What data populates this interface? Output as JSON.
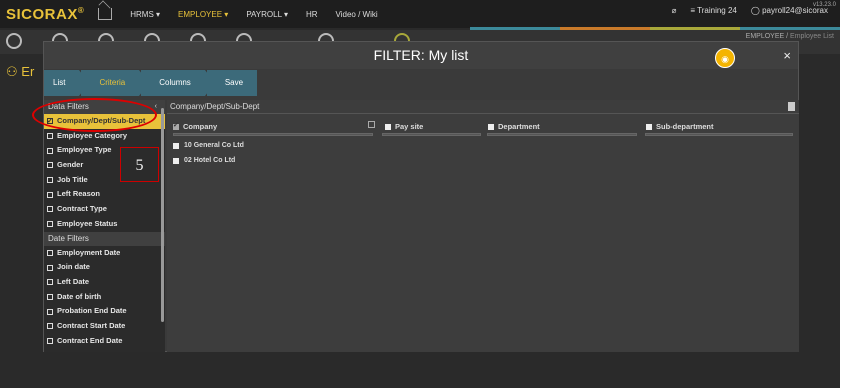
{
  "app": {
    "logo": "SICORAX",
    "logo_mark": "®",
    "version": "v13.23.0",
    "nav": [
      "HRMS ▾",
      "EMPLOYEE ▾",
      "PAYROLL ▾",
      "HR",
      "Video / Wiki"
    ],
    "training": "Training 24",
    "user": "payroll24@sicorax",
    "breadcrumb_a": "EMPLOYEE /",
    "breadcrumb_b": "Employee List",
    "page_title_fragment": "Er"
  },
  "modal": {
    "title": "FILTER: My list",
    "close": "×",
    "steps": [
      "List",
      "Criteria",
      "Columns",
      "Save"
    ]
  },
  "left": {
    "data_filters_label": "Data Filters",
    "data_filters_caret": "‹",
    "data_filters": [
      "Company/Dept/Sub-Dept",
      "Employee Category",
      "Employee Type",
      "Gender",
      "Job Title",
      "Left Reason",
      "Contract Type",
      "Employee Status"
    ],
    "date_filters_label": "Date Filters",
    "date_filters": [
      "Employment Date",
      "Join date",
      "Left Date",
      "Date of birth",
      "Probation End Date",
      "Contract Start Date",
      "Contract End Date"
    ]
  },
  "annotation_number": "5",
  "right": {
    "title": "Company/Dept/Sub-Dept",
    "columns": [
      "Company",
      "Pay site",
      "Department",
      "Sub-department"
    ],
    "companies": [
      "10 General Co Ltd",
      "02 Hotel Co Ltd"
    ]
  },
  "colors": {
    "accent": "#e8c23a",
    "step_bg": "#3c6a7a",
    "highlight_ring": "#dd0000"
  }
}
